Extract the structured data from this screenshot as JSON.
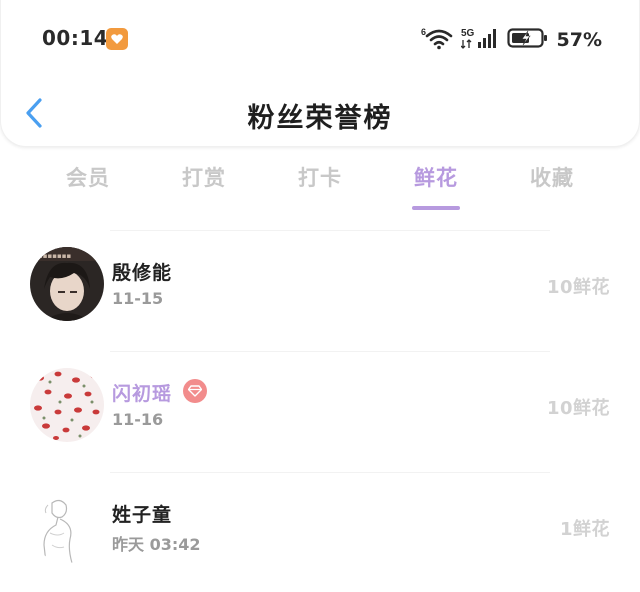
{
  "status_bar": {
    "time": "00:14",
    "battery_percent": "57%",
    "network_label": "5G",
    "wifi_label": "6",
    "icons": [
      "app-badge-icon",
      "wifi-icon",
      "signal-icon",
      "battery-icon"
    ]
  },
  "nav": {
    "title": "粉丝荣誉榜",
    "back_icon": "chevron-left-icon"
  },
  "tabs": [
    {
      "label": "会员",
      "active": false
    },
    {
      "label": "打赏",
      "active": false
    },
    {
      "label": "打卡",
      "active": false
    },
    {
      "label": "鲜花",
      "active": true
    },
    {
      "label": "收藏",
      "active": false
    }
  ],
  "list": [
    {
      "name": "殷修能",
      "date": "11-15",
      "count": "10鲜花",
      "vip": false
    },
    {
      "name": "闪初瑶",
      "date": "11-16",
      "count": "10鲜花",
      "vip": true
    },
    {
      "name": "姓子童",
      "date": "昨天 03:42",
      "count": "1鲜花",
      "vip": false
    }
  ],
  "colors": {
    "accent": "#b79adf",
    "tab_inactive": "#c8c8c8",
    "count_text": "#d2d2d2",
    "vip_badge": "#f28c8c",
    "app_badge": "#f29a3e",
    "back_arrow": "#4a9ff0"
  }
}
